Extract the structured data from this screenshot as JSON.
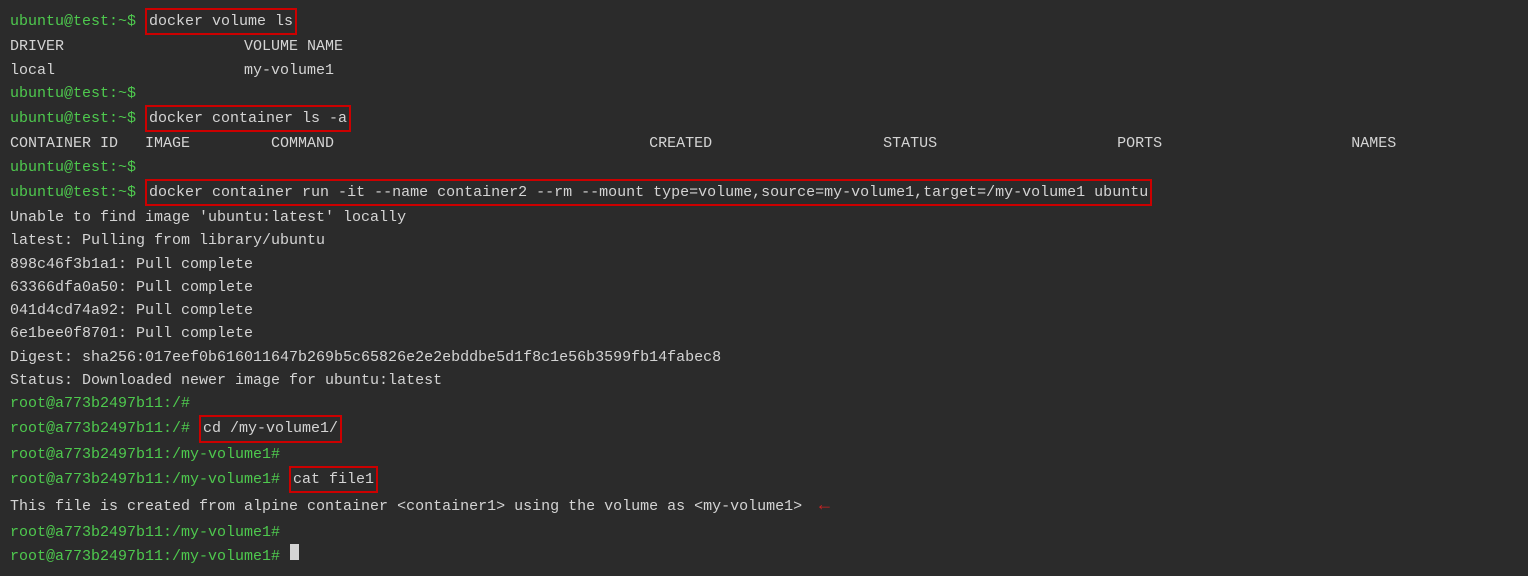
{
  "terminal": {
    "lines": [
      {
        "id": "l1",
        "prompt": "ubuntu@test:~$ ",
        "cmd_highlighted": "docker volume ls",
        "rest": ""
      },
      {
        "id": "l2",
        "prompt": "",
        "text": "DRIVER                    VOLUME NAME"
      },
      {
        "id": "l3",
        "prompt": "",
        "text": "local                     my-volume1"
      },
      {
        "id": "l4",
        "prompt": "ubuntu@test:~$ ",
        "text": ""
      },
      {
        "id": "l5",
        "prompt": "ubuntu@test:~$ ",
        "cmd_highlighted": "docker container ls -a",
        "rest": ""
      },
      {
        "id": "l6",
        "prompt": "",
        "text": "CONTAINER ID   IMAGE         COMMAND       CREATED       STATUS        PORTS         NAMES"
      },
      {
        "id": "l7",
        "prompt": "ubuntu@test:~$ ",
        "text": ""
      },
      {
        "id": "l8",
        "prompt": "ubuntu@test:~$ ",
        "cmd_highlighted": "docker container run -it --name container2 --rm --mount type=volume,source=my-volume1,target=/my-volume1 ubuntu",
        "rest": ""
      },
      {
        "id": "l9",
        "prompt": "",
        "text": "Unable to find image 'ubuntu:latest' locally"
      },
      {
        "id": "l10",
        "prompt": "",
        "text": "latest: Pulling from library/ubuntu"
      },
      {
        "id": "l11",
        "prompt": "",
        "text": "898c46f3b1a1: Pull complete"
      },
      {
        "id": "l12",
        "prompt": "",
        "text": "63366dfa0a50: Pull complete"
      },
      {
        "id": "l13",
        "prompt": "",
        "text": "041d4cd74a92: Pull complete"
      },
      {
        "id": "l14",
        "prompt": "",
        "text": "6e1bee0f8701: Pull complete"
      },
      {
        "id": "l15",
        "prompt": "",
        "text": "Digest: sha256:017eef0b616011647b269b5c65826e2e2ebddbe5d1f8c1e56b3599fb14fabec8"
      },
      {
        "id": "l16",
        "prompt": "",
        "text": "Status: Downloaded newer image for ubuntu:latest"
      },
      {
        "id": "l17",
        "prompt": "root@a773b2497b11:/# ",
        "text": ""
      },
      {
        "id": "l18",
        "prompt": "root@a773b2497b11:/# ",
        "cmd_highlighted": "cd /my-volume1/",
        "rest": ""
      },
      {
        "id": "l19",
        "prompt": "root@a773b2497b11:/my-volume1# ",
        "text": ""
      },
      {
        "id": "l20",
        "prompt": "root@a773b2497b11:/my-volume1# ",
        "cmd_highlighted": "cat file1",
        "rest": ""
      },
      {
        "id": "l21",
        "prompt": "",
        "text": "This file is created from alpine container <container1> using the volume as <my-volume1>",
        "arrow": true
      },
      {
        "id": "l22",
        "prompt": "root@a773b2497b11:/my-volume1# ",
        "text": ""
      },
      {
        "id": "l23",
        "prompt": "root@a773b2497b11:/my-volume1# ",
        "text": "",
        "cursor": true
      }
    ]
  }
}
